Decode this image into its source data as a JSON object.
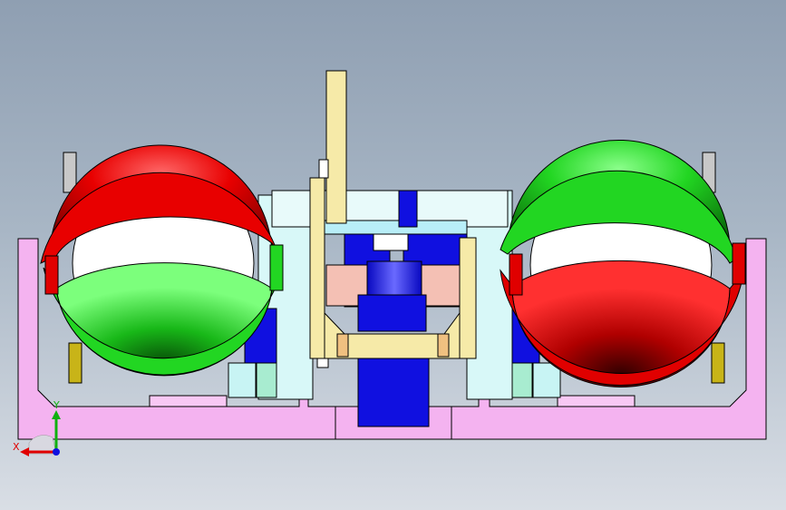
{
  "viewport": {
    "background_top": "#8f9fb2",
    "background_bottom": "#d9dee5"
  },
  "colors": {
    "base_frame": "#f4b3f0",
    "sphere_red": "#e00000",
    "sphere_green": "#1ecf1e",
    "insert_blue": "#1010e0",
    "light_cyan": "#c8f4f4",
    "mint": "#a8ecd0",
    "cream": "#f6eaa8",
    "salmon": "#f4c0b4",
    "nut_yellow": "#c8b418",
    "bolt_grey": "#c8c8c8",
    "white": "#ffffff"
  },
  "triad": {
    "x_label": "X",
    "y_label": "Y"
  }
}
